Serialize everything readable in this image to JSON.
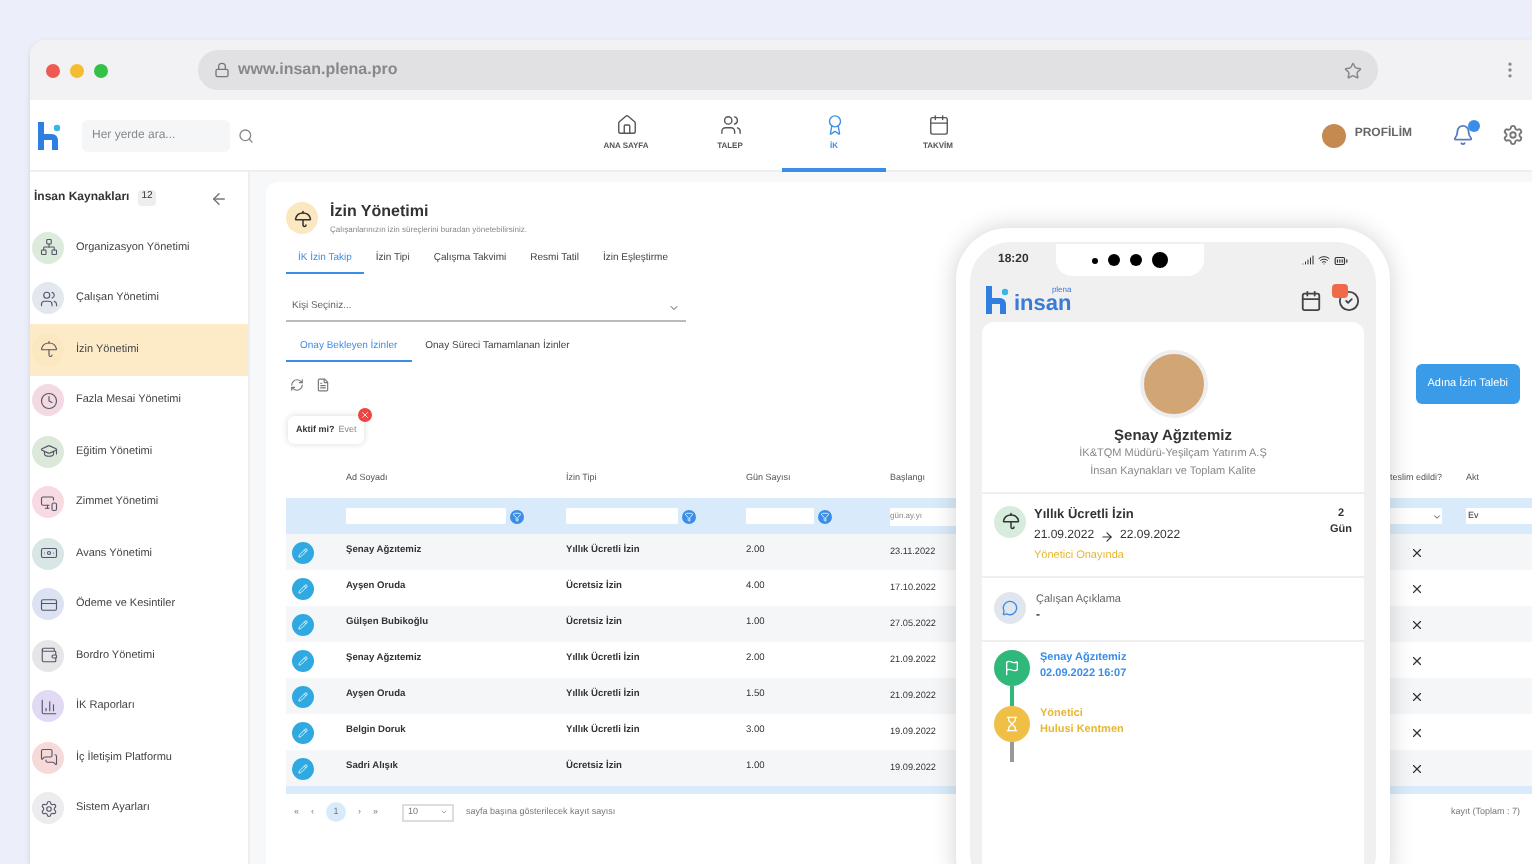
{
  "browser": {
    "url": "www.insan.plena.pro"
  },
  "header": {
    "search": {
      "placeholder": "Her yerde ara..."
    },
    "nav": [
      {
        "label": "ANA SAYFA",
        "selected": false
      },
      {
        "label": "TALEP",
        "selected": false
      },
      {
        "label": "İK",
        "selected": true
      },
      {
        "label": "TAKVİM",
        "selected": false
      }
    ],
    "profile": "PROFİLİM"
  },
  "sidebar": {
    "title": "İnsan Kaynakları",
    "count": "12",
    "items": [
      {
        "label": "Organizasyon Yönetimi",
        "color": "#dcebdc",
        "selected": false
      },
      {
        "label": "Çalışan Yönetimi",
        "color": "#e2e8ee",
        "selected": false
      },
      {
        "label": "İzin Yönetimi",
        "color": "#fbe7c0",
        "selected": true
      },
      {
        "label": "Fazla Mesai Yönetimi",
        "color": "#f2d9e2",
        "selected": false
      },
      {
        "label": "Eğitim Yönetimi",
        "color": "#dbe8da",
        "selected": false
      },
      {
        "label": "Zimmet Yönetimi",
        "color": "#f8dbe2",
        "selected": false
      },
      {
        "label": "Avans Yönetimi",
        "color": "#d9e6e6",
        "selected": false
      },
      {
        "label": "Ödeme ve Kesintiler",
        "color": "#dbe3f3",
        "selected": false
      },
      {
        "label": "Bordro Yönetimi",
        "color": "#e6e6e8",
        "selected": false
      },
      {
        "label": "İK Raporları",
        "color": "#e2daf4",
        "selected": false
      },
      {
        "label": "İç İletişim Platformu",
        "color": "#f6dada",
        "selected": false
      },
      {
        "label": "Sistem Ayarları",
        "color": "#ececee",
        "selected": false
      }
    ]
  },
  "page": {
    "title": "İzin Yönetimi",
    "subtitle": "Çalışanlarınızın izin süreçlerini buradan yönetebilirsiniz.",
    "tabs": [
      {
        "label": "İK İzin Takip",
        "selected": true
      },
      {
        "label": "İzin Tipi",
        "selected": false
      },
      {
        "label": "Çalışma Takvimi",
        "selected": false
      },
      {
        "label": "Resmi Tatil",
        "selected": false
      },
      {
        "label": "İzin Eşleştirme",
        "selected": false
      }
    ],
    "person_select": {
      "placeholder": "Kişi Seçiniz..."
    },
    "subtabs": [
      {
        "label": "Onay Bekleyen İzinler",
        "selected": true
      },
      {
        "label": "Onay Süreci Tamamlanan İzinler",
        "selected": false
      }
    ],
    "request_button": "Adına İzin Talebi",
    "filter_chip": {
      "label": "Aktif mi?",
      "value": "Evet"
    },
    "table": {
      "columns": [
        "Ad Soyadı",
        "İzin Tipi",
        "Gün Sayısı",
        "Başlangı",
        "teslim edildi?",
        "Akt"
      ],
      "filters": {
        "start_placeholder": "gün.ay.yı",
        "active_value": "Ev"
      },
      "rows": [
        {
          "name": "Şenay Ağzıtemiz",
          "type": "Yıllık Ücretli İzin",
          "days": "2.00",
          "start": "23.11.2022"
        },
        {
          "name": "Ayşen Oruda",
          "type": "Ücretsiz İzin",
          "days": "4.00",
          "start": "17.10.2022"
        },
        {
          "name": "Gülşen Bubikoğlu",
          "type": "Ücretsiz İzin",
          "days": "1.00",
          "start": "27.05.2022"
        },
        {
          "name": "Şenay Ağzıtemiz",
          "type": "Yıllık Ücretli İzin",
          "days": "2.00",
          "start": "21.09.2022"
        },
        {
          "name": "Ayşen Oruda",
          "type": "Yıllık Ücretli İzin",
          "days": "1.50",
          "start": "21.09.2022"
        },
        {
          "name": "Belgin Doruk",
          "type": "Yıllık Ücretli İzin",
          "days": "3.00",
          "start": "19.09.2022"
        },
        {
          "name": "Sadri Alışık",
          "type": "Ücretsiz İzin",
          "days": "1.00",
          "start": "19.09.2022"
        }
      ]
    },
    "pagination": {
      "first": "«",
      "prev": "‹",
      "page": "1",
      "next": "›",
      "last": "»",
      "page_size": "10",
      "page_size_label": "sayfa başına gösterilecek kayıt sayısı",
      "total": "kayıt (Toplam : 7)"
    }
  },
  "phone": {
    "time": "18:20",
    "logo_small": "plena",
    "logo": "insan",
    "profile": {
      "name": "Şenay Ağzıtemiz",
      "role": "İK&TQM Müdürü-Yeşilçam Yatırım A.Ş",
      "department": "İnsan Kaynakları ve Toplam Kalite"
    },
    "leave": {
      "type": "Yıllık Ücretli İzin",
      "from": "21.09.2022",
      "to": "22.09.2022",
      "status": "Yönetici Onayında",
      "days": "2",
      "days_unit": "Gün"
    },
    "comment": {
      "label": "Çalışan Açıklama",
      "value": "-"
    },
    "timeline": [
      {
        "kind": "done",
        "title": "Şenay Ağzıtemiz",
        "detail": "02.09.2022 16:07",
        "color": "#2fb87a"
      },
      {
        "kind": "waiting",
        "title": "Yönetici",
        "detail": "Hulusi Kentmen",
        "color": "#f0bf45"
      }
    ]
  }
}
